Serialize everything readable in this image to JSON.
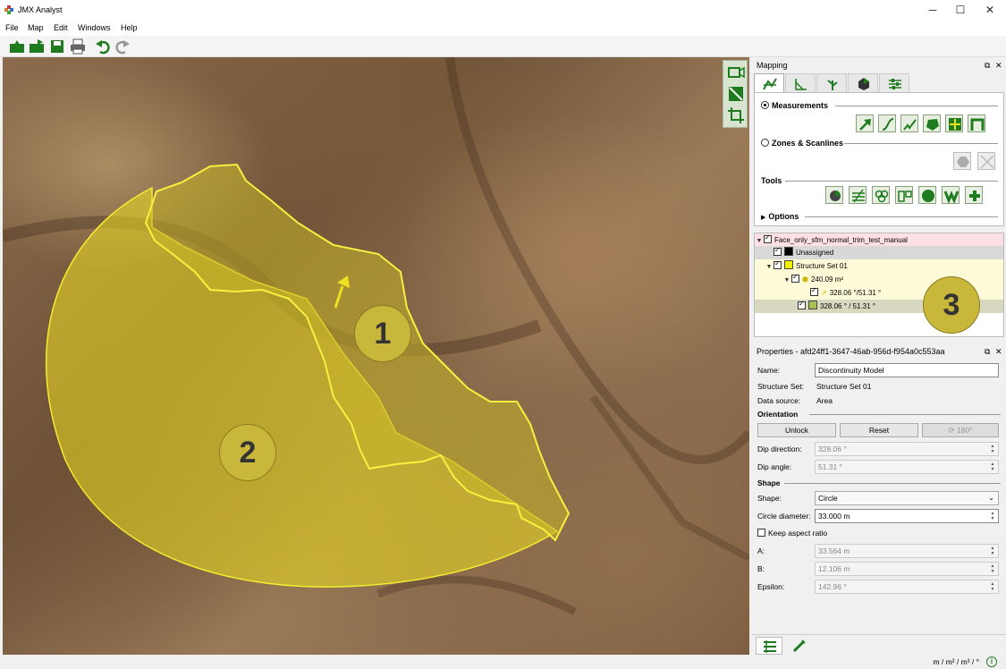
{
  "window": {
    "title": "JMX Analyst",
    "minimize": "─",
    "maximize": "☐",
    "close": "✕"
  },
  "menu": [
    "File",
    "Map",
    "Edit",
    "Windows",
    "Help"
  ],
  "viewport": {
    "markers": [
      "1",
      "2",
      "3"
    ]
  },
  "mapping": {
    "title": "Mapping",
    "measurements_label": "Measurements",
    "zones_label": "Zones & Scanlines",
    "tools_label": "Tools",
    "options_label": "Options"
  },
  "tree": {
    "root": "Face_only_sfm_normal_trim_test_manual",
    "unassigned": "Unassigned",
    "structure_set": "Structure Set 01",
    "area": "240.09 m²",
    "measure": "328.06 °/51.31 °",
    "model": "328.06 ° / 51.31 °"
  },
  "properties": {
    "title": "Properties - afd24ff1-3647-46ab-956d-f954a0c553aa",
    "name_label": "Name:",
    "name_value": "Discontinuity Model",
    "structure_set_label": "Structure Set:",
    "structure_set_value": "Structure Set 01",
    "data_source_label": "Data source:",
    "data_source_value": "Area",
    "orientation_label": "Orientation",
    "unlock": "Unlock",
    "reset": "Reset",
    "rotate": "180°",
    "dip_direction_label": "Dip direction:",
    "dip_direction_value": "328.06 °",
    "dip_angle_label": "Dip angle:",
    "dip_angle_value": "51.31 °",
    "shape_section": "Shape",
    "shape_label": "Shape:",
    "shape_value": "Circle",
    "diameter_label": "Circle diameter:",
    "diameter_value": "33.000 m",
    "keep_aspect": "Keep aspect ratio",
    "a_label": "A:",
    "a_value": "33.564 m",
    "b_label": "B:",
    "b_value": "12.106 m",
    "epsilon_label": "Epsilon:",
    "epsilon_value": "142.96 °"
  },
  "status": {
    "units": "m / m² / m³ / °",
    "info": "i"
  },
  "colors": {
    "accent_green": "#2d7d2d",
    "polygon_yellow": "#f0e020",
    "marker_gold": "#c9b73c",
    "tree_highlight": "#fde0e4",
    "structure_yellow": "#fffbd8"
  }
}
